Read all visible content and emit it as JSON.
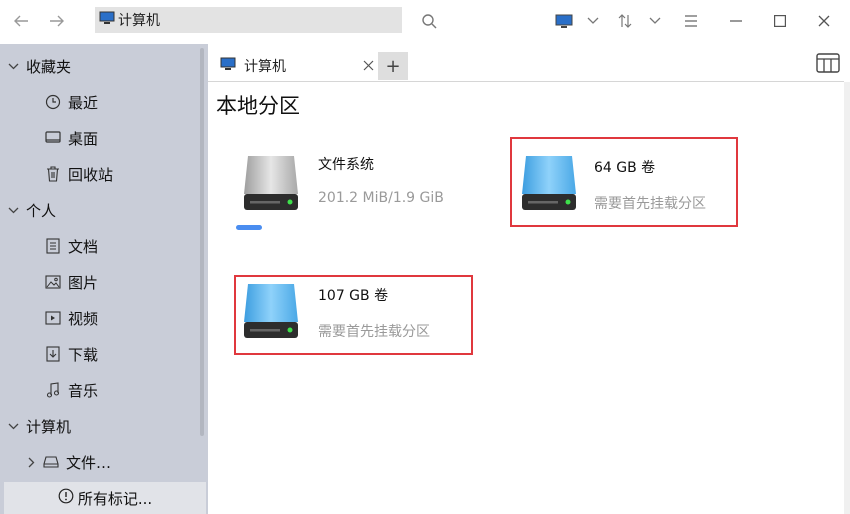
{
  "toolbar": {
    "back": "back-arrow",
    "forward": "forward-arrow",
    "address": "计算机",
    "search": "search-icon"
  },
  "sidebar": {
    "groups": [
      {
        "label": "收藏夹"
      },
      {
        "label": "个人"
      },
      {
        "label": "计算机"
      }
    ],
    "items": [
      {
        "label": "最近"
      },
      {
        "label": "桌面"
      },
      {
        "label": "回收站"
      },
      {
        "label": "文档"
      },
      {
        "label": "图片"
      },
      {
        "label": "视频"
      },
      {
        "label": "下载"
      },
      {
        "label": "音乐"
      },
      {
        "label": "文件…"
      }
    ],
    "bottom": "所有标记..."
  },
  "tab": {
    "label": "计算机",
    "add": "+"
  },
  "content": {
    "title": "本地分区",
    "drives": [
      {
        "name": "文件系统",
        "sub": "201.2 MiB/1.9 GiB",
        "color": "#b0b0b0",
        "usage": 0.1
      },
      {
        "name": "64 GB 卷",
        "sub": "需要首先挂载分区",
        "color": "#5ab4f0"
      },
      {
        "name": "107 GB 卷",
        "sub": "需要首先挂载分区",
        "color": "#5ab4f0"
      }
    ]
  },
  "colors": {
    "sidebar": "#c9cdd8",
    "highlight": "#e0383e",
    "accent": "#4a8df0"
  }
}
